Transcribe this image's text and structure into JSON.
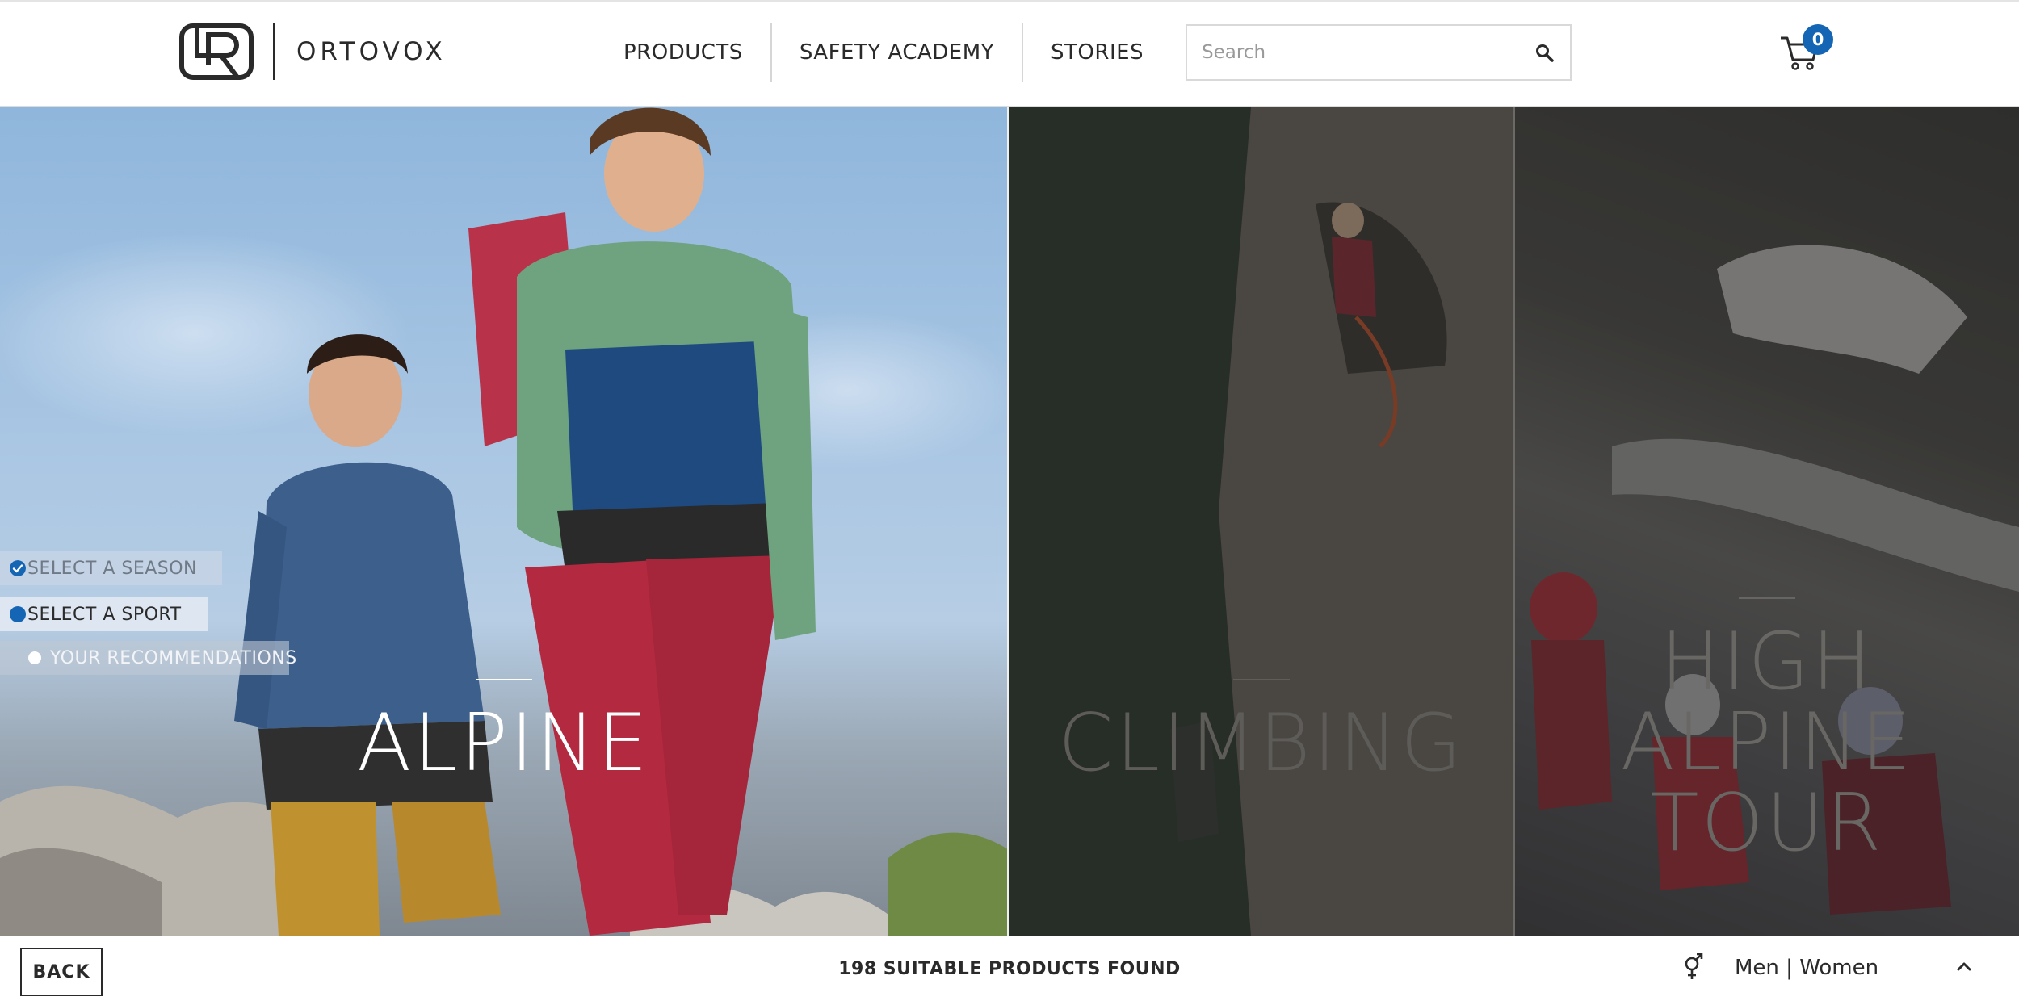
{
  "header": {
    "brand": "ORTOVOX",
    "nav": [
      {
        "label": "PRODUCTS"
      },
      {
        "label": "SAFETY ACADEMY"
      },
      {
        "label": "STORIES"
      }
    ],
    "search": {
      "placeholder": "Search",
      "value": ""
    },
    "cart": {
      "count": "0"
    }
  },
  "steps": [
    {
      "label": "SELECT A SEASON",
      "state": "done"
    },
    {
      "label": "SELECT A SPORT",
      "state": "active"
    },
    {
      "label": "YOUR RECOMMENDATIONS",
      "state": "pending"
    }
  ],
  "panels": [
    {
      "title": "ALPINE",
      "state": "hover"
    },
    {
      "title": "CLIMBING",
      "state": "dimmed"
    },
    {
      "title_line1": "HIGH ALPINE",
      "title_line2": "TOUR",
      "state": "dimmed"
    }
  ],
  "footer": {
    "back_label": "BACK",
    "found_text": "198 SUITABLE PRODUCTS FOUND",
    "gender_value": "Men | Women"
  },
  "colors": {
    "accent": "#1565b5",
    "text": "#2a2a2a"
  }
}
